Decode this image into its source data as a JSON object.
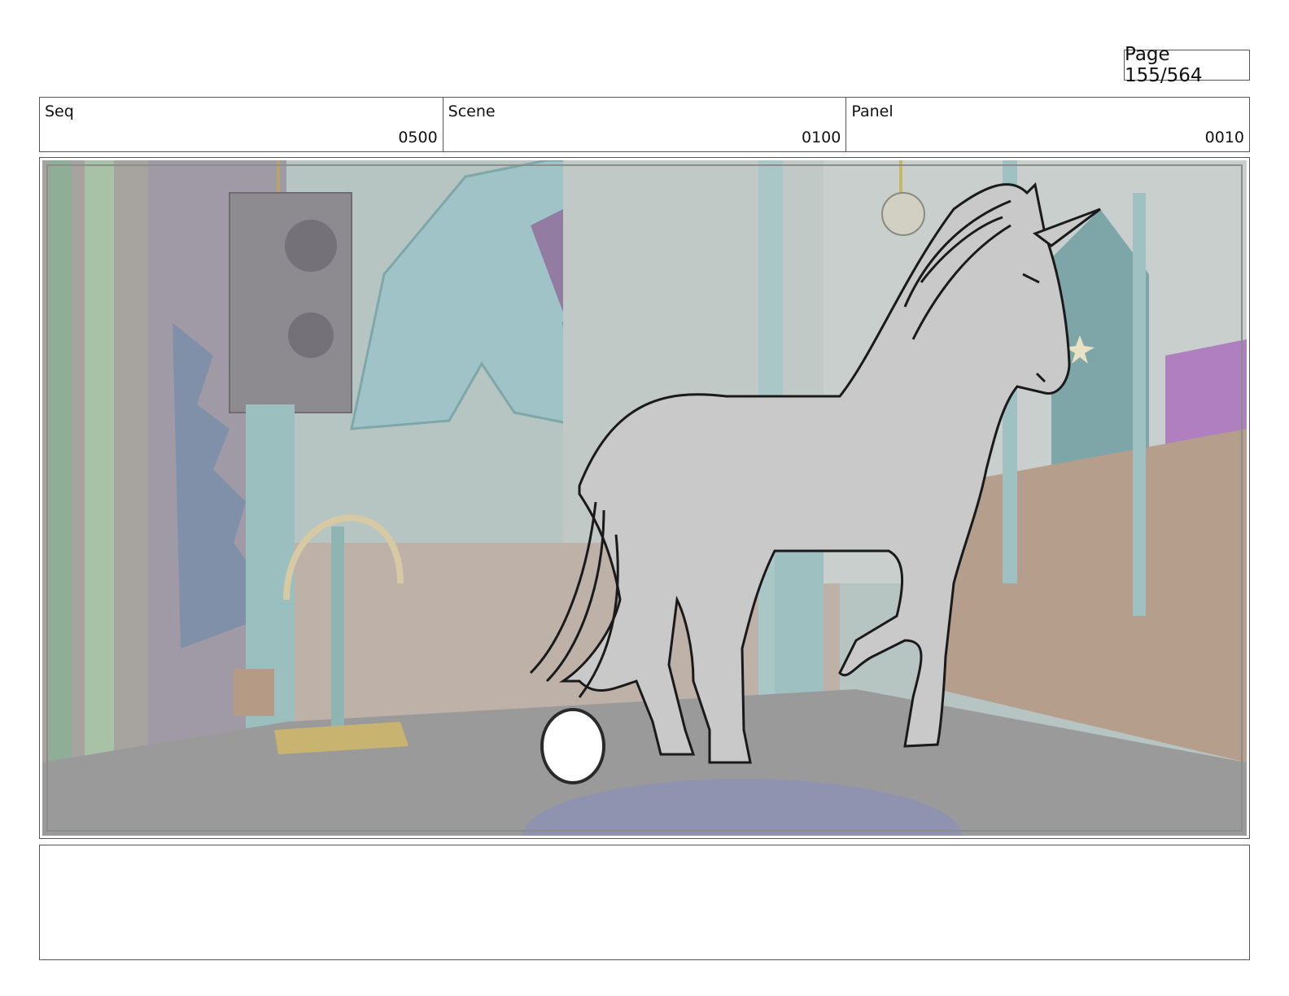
{
  "page": {
    "label": "Page 155/564"
  },
  "header": {
    "seq": {
      "label": "Seq",
      "value": "0500"
    },
    "scene": {
      "label": "Scene",
      "value": "0100"
    },
    "panel": {
      "label": "Panel",
      "value": "0010"
    }
  },
  "notes": {
    "text": ""
  },
  "colors": {
    "teal": "#8fc0c0",
    "purple": "#a06aa8",
    "floor": "#8e8e8e",
    "horse": "#c8c8c8",
    "wood": "#b89a86"
  }
}
